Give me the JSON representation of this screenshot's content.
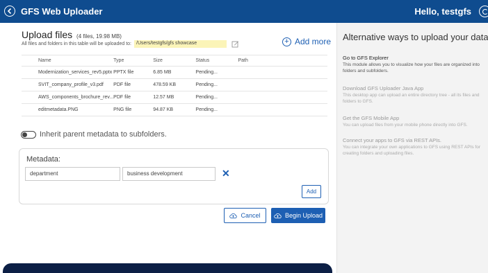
{
  "header": {
    "title": "GFS Web Uploader",
    "greeting": "Hello, testgfs"
  },
  "upload": {
    "title": "Upload files",
    "count": "(4 files, 19.98 MB)",
    "dest_text": "All files and folders in this table will be uploaded to:",
    "dest_path": "/Users/testgfs/gfs showcase",
    "add_more": "Add more"
  },
  "table": {
    "headers": [
      "Name",
      "Type",
      "Size",
      "Status",
      "Path"
    ],
    "rows": [
      {
        "name": "Modernization_services_rev5.pptx",
        "type": "PPTX file",
        "size": "6.85 MB",
        "status": "Pending...",
        "path": ""
      },
      {
        "name": "SVIT_company_profile_v3.pdf",
        "type": "PDF file",
        "size": "478.59 KB",
        "status": "Pending...",
        "path": ""
      },
      {
        "name": "AWS_components_brochure_rev...",
        "type": "PDF file",
        "size": "12.57 MB",
        "status": "Pending...",
        "path": ""
      },
      {
        "name": "editmetadata.PNG",
        "type": "PNG file",
        "size": "94.87 KB",
        "status": "Pending...",
        "path": ""
      }
    ]
  },
  "inherit": {
    "label": "Inherit parent metadata to subfolders.",
    "enabled": false
  },
  "metadata": {
    "label": "Metadata:",
    "key": "department",
    "value": "business development",
    "add_label": "Add"
  },
  "actions": {
    "cancel": "Cancel",
    "begin": "Begin Upload"
  },
  "sidebar": {
    "title": "Alternative ways to upload your data",
    "items": [
      {
        "heading": "Go to GFS Explorer",
        "desc": "This module allows you to visualize how your files are organized into folders and subfolders."
      },
      {
        "heading": "Download GFS Uploader Java App",
        "desc": "This desktop app can upload an entire directory tree - all its files and folders to GFS."
      },
      {
        "heading": "Get the GFS Mobile App",
        "desc": "You can upload files from your mobile phone directly into GFS."
      },
      {
        "heading": "Connect your apps to GFS via REST APIs.",
        "desc": "You can integrate your own applications to GFS using REST APIs for creating folders and uploading files."
      }
    ]
  },
  "colors": {
    "header_bg": "#0f4c8f",
    "accent": "#1d5fb3",
    "path_highlight": "#fbf4b8",
    "panel_dark": "#0c1f45"
  }
}
